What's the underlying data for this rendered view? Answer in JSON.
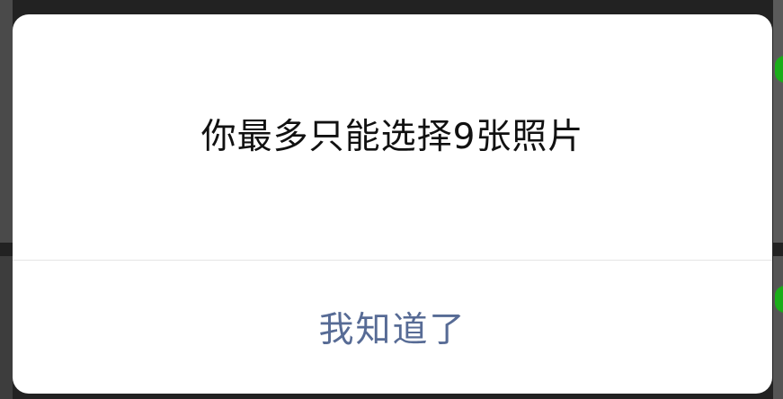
{
  "dialog": {
    "message": "你最多只能选择9张照片",
    "confirm_label": "我知道了"
  },
  "colors": {
    "dialog_bg": "#ffffff",
    "message_text": "#111111",
    "confirm_text": "#576b95",
    "divider": "#e5e5e5",
    "backdrop": "#222222",
    "badge_green": "#1aad19"
  }
}
